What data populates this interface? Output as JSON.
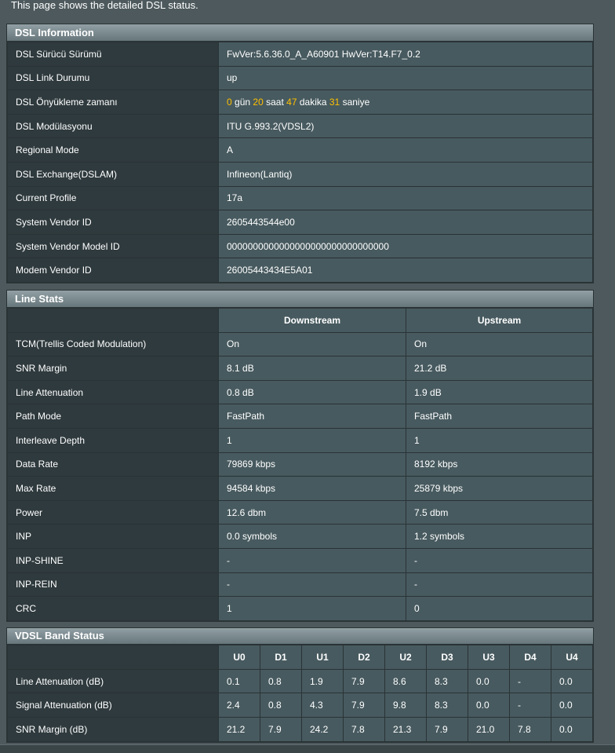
{
  "intro": "This page shows the detailed DSL status.",
  "dsl_info": {
    "title": "DSL Information",
    "rows": [
      {
        "label": "DSL Sürücü Sürümü",
        "value": "FwVer:5.6.36.0_A_A60901 HwVer:T14.F7_0.2"
      },
      {
        "label": "DSL Link Durumu",
        "value": "up"
      },
      {
        "label": "DSL Önyükleme zamanı",
        "value": ""
      },
      {
        "label": "DSL Modülasyonu",
        "value": "ITU G.993.2(VDSL2)"
      },
      {
        "label": "Regional Mode",
        "value": "A"
      },
      {
        "label": "DSL Exchange(DSLAM)",
        "value": "Infineon(Lantiq)"
      },
      {
        "label": "Current Profile",
        "value": "17a"
      },
      {
        "label": "System Vendor ID",
        "value": "2605443544e00"
      },
      {
        "label": "System Vendor Model ID",
        "value": "0000000000000000000000000000000"
      },
      {
        "label": "Modem Vendor ID",
        "value": "26005443434E5A01"
      }
    ],
    "uptime": {
      "days": "0",
      "days_unit": "gün",
      "hours": "20",
      "hours_unit": "saat",
      "minutes": "47",
      "minutes_unit": "dakika",
      "seconds": "31",
      "seconds_unit": "saniye"
    }
  },
  "line_stats": {
    "title": "Line Stats",
    "col_down": "Downstream",
    "col_up": "Upstream",
    "rows": [
      {
        "label": "TCM(Trellis Coded Modulation)",
        "down": "On",
        "up": "On"
      },
      {
        "label": "SNR Margin",
        "down": "8.1 dB",
        "up": "21.2 dB"
      },
      {
        "label": "Line Attenuation",
        "down": "0.8 dB",
        "up": "1.9 dB"
      },
      {
        "label": "Path Mode",
        "down": "FastPath",
        "up": "FastPath"
      },
      {
        "label": "Interleave Depth",
        "down": "1",
        "up": "1"
      },
      {
        "label": "Data Rate",
        "down": "79869 kbps",
        "up": "8192 kbps"
      },
      {
        "label": "Max Rate",
        "down": "94584 kbps",
        "up": "25879 kbps"
      },
      {
        "label": "Power",
        "down": "12.6 dbm",
        "up": "7.5 dbm"
      },
      {
        "label": "INP",
        "down": "0.0 symbols",
        "up": "1.2 symbols"
      },
      {
        "label": "INP-SHINE",
        "down": "-",
        "up": "-"
      },
      {
        "label": "INP-REIN",
        "down": "-",
        "up": "-"
      },
      {
        "label": "CRC",
        "down": "1",
        "up": "0"
      }
    ]
  },
  "vdsl_band": {
    "title": "VDSL Band Status",
    "bands": [
      "U0",
      "D1",
      "U1",
      "D2",
      "U2",
      "D3",
      "U3",
      "D4",
      "U4"
    ],
    "rows": [
      {
        "label": "Line Attenuation (dB)",
        "values": [
          "0.1",
          "0.8",
          "1.9",
          "7.9",
          "8.6",
          "8.3",
          "0.0",
          "-",
          "0.0"
        ]
      },
      {
        "label": "Signal Attenuation (dB)",
        "values": [
          "2.4",
          "0.8",
          "4.3",
          "7.9",
          "9.8",
          "8.3",
          "0.0",
          "-",
          "0.0"
        ]
      },
      {
        "label": "SNR Margin (dB)",
        "values": [
          "21.2",
          "7.9",
          "24.2",
          "7.8",
          "21.3",
          "7.9",
          "21.0",
          "7.8",
          "0.0"
        ]
      }
    ]
  },
  "colors": {
    "highlight": "#ffc000",
    "upstream_band": "#36aaff",
    "downstream_band": "#ff9a30"
  }
}
